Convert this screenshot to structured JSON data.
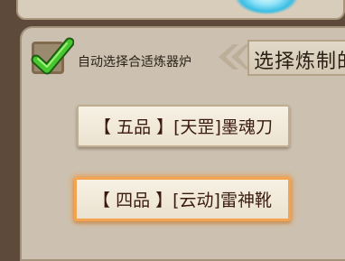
{
  "auto_select": {
    "checked": true,
    "label": "自动选择合适炼器炉"
  },
  "header": {
    "title": "选择炼制的"
  },
  "items": [
    {
      "label": "【 五品 】[天罡]墨魂刀",
      "selected": false
    },
    {
      "label": "【 四品 】[云动]雷神靴",
      "selected": true
    }
  ],
  "colors": {
    "accent_glow": "#f2a450",
    "check_green": "#3fc22a"
  }
}
